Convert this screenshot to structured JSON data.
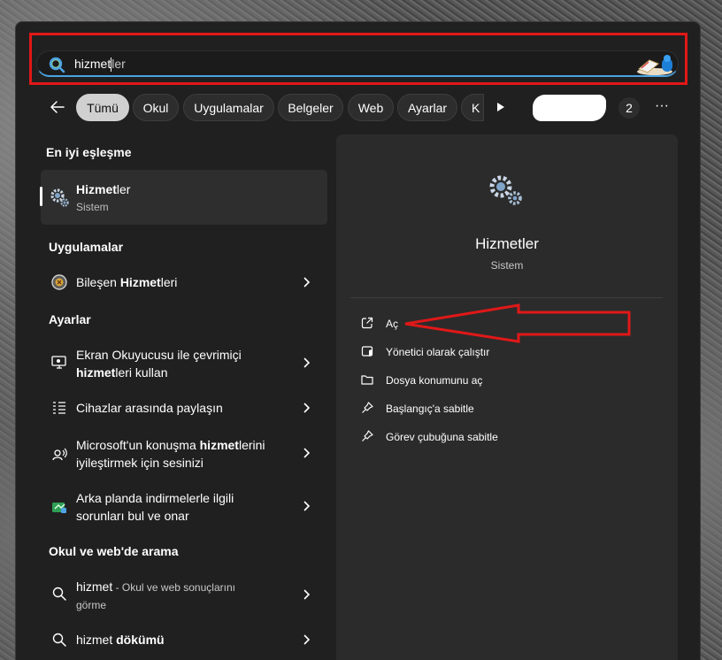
{
  "search": {
    "query_typed": "hizmet",
    "query_completion": "ler"
  },
  "filters": {
    "chips": [
      "Tümü",
      "Okul",
      "Uygulamalar",
      "Belgeler",
      "Web",
      "Ayarlar",
      "K"
    ],
    "count": "2",
    "more": "···"
  },
  "left": {
    "best_match_header": "En iyi eşleşme",
    "best": {
      "bold": "Hizmet",
      "rest": "ler",
      "sub": "Sistem"
    },
    "apps_header": "Uygulamalar",
    "app": {
      "pre": "Bileşen ",
      "bold": "Hizmet",
      "post": "leri"
    },
    "settings_header": "Ayarlar",
    "setting1": {
      "line1": "Ekran Okuyucusu ile çevrimiçi",
      "bold": "hizmet",
      "rest": "leri kullan"
    },
    "setting2": {
      "line1": "Cihazlar arasında paylaşın"
    },
    "setting3": {
      "pre": "Microsoft'un konuşma ",
      "bold": "hizmet",
      "post": "lerini",
      "line2": "iyileştirmek için sesinizi"
    },
    "setting4": {
      "line1": "Arka planda indirmelerle ilgili",
      "line2": "sorunları bul ve onar"
    },
    "web_header": "Okul ve web'de arama",
    "web1": {
      "query": "hizmet",
      "suffix": " - Okul ve web sonuçlarını",
      "line2": "görme"
    },
    "web2": {
      "pre": "hizmet ",
      "bold": "dökümü"
    }
  },
  "right": {
    "title": "Hizmetler",
    "subtitle": "Sistem",
    "actions": [
      "Aç",
      "Yönetici olarak çalıştır",
      "Dosya konumunu aç",
      "Başlangıç'a sabitle",
      "Görev çubuğuna sabitle"
    ]
  },
  "colors": {
    "highlight": "#e01818",
    "accent": "#4ba3e3",
    "panel": "#202020",
    "detail": "#2b2b2b"
  },
  "icons": [
    "search-icon",
    "back-arrow-icon",
    "play-icon",
    "gear-icon",
    "component-services-icon",
    "narrator-icon",
    "share-icon",
    "speech-icon",
    "troubleshoot-icon",
    "open-icon",
    "shield-icon",
    "folder-icon",
    "pin-icon"
  ]
}
